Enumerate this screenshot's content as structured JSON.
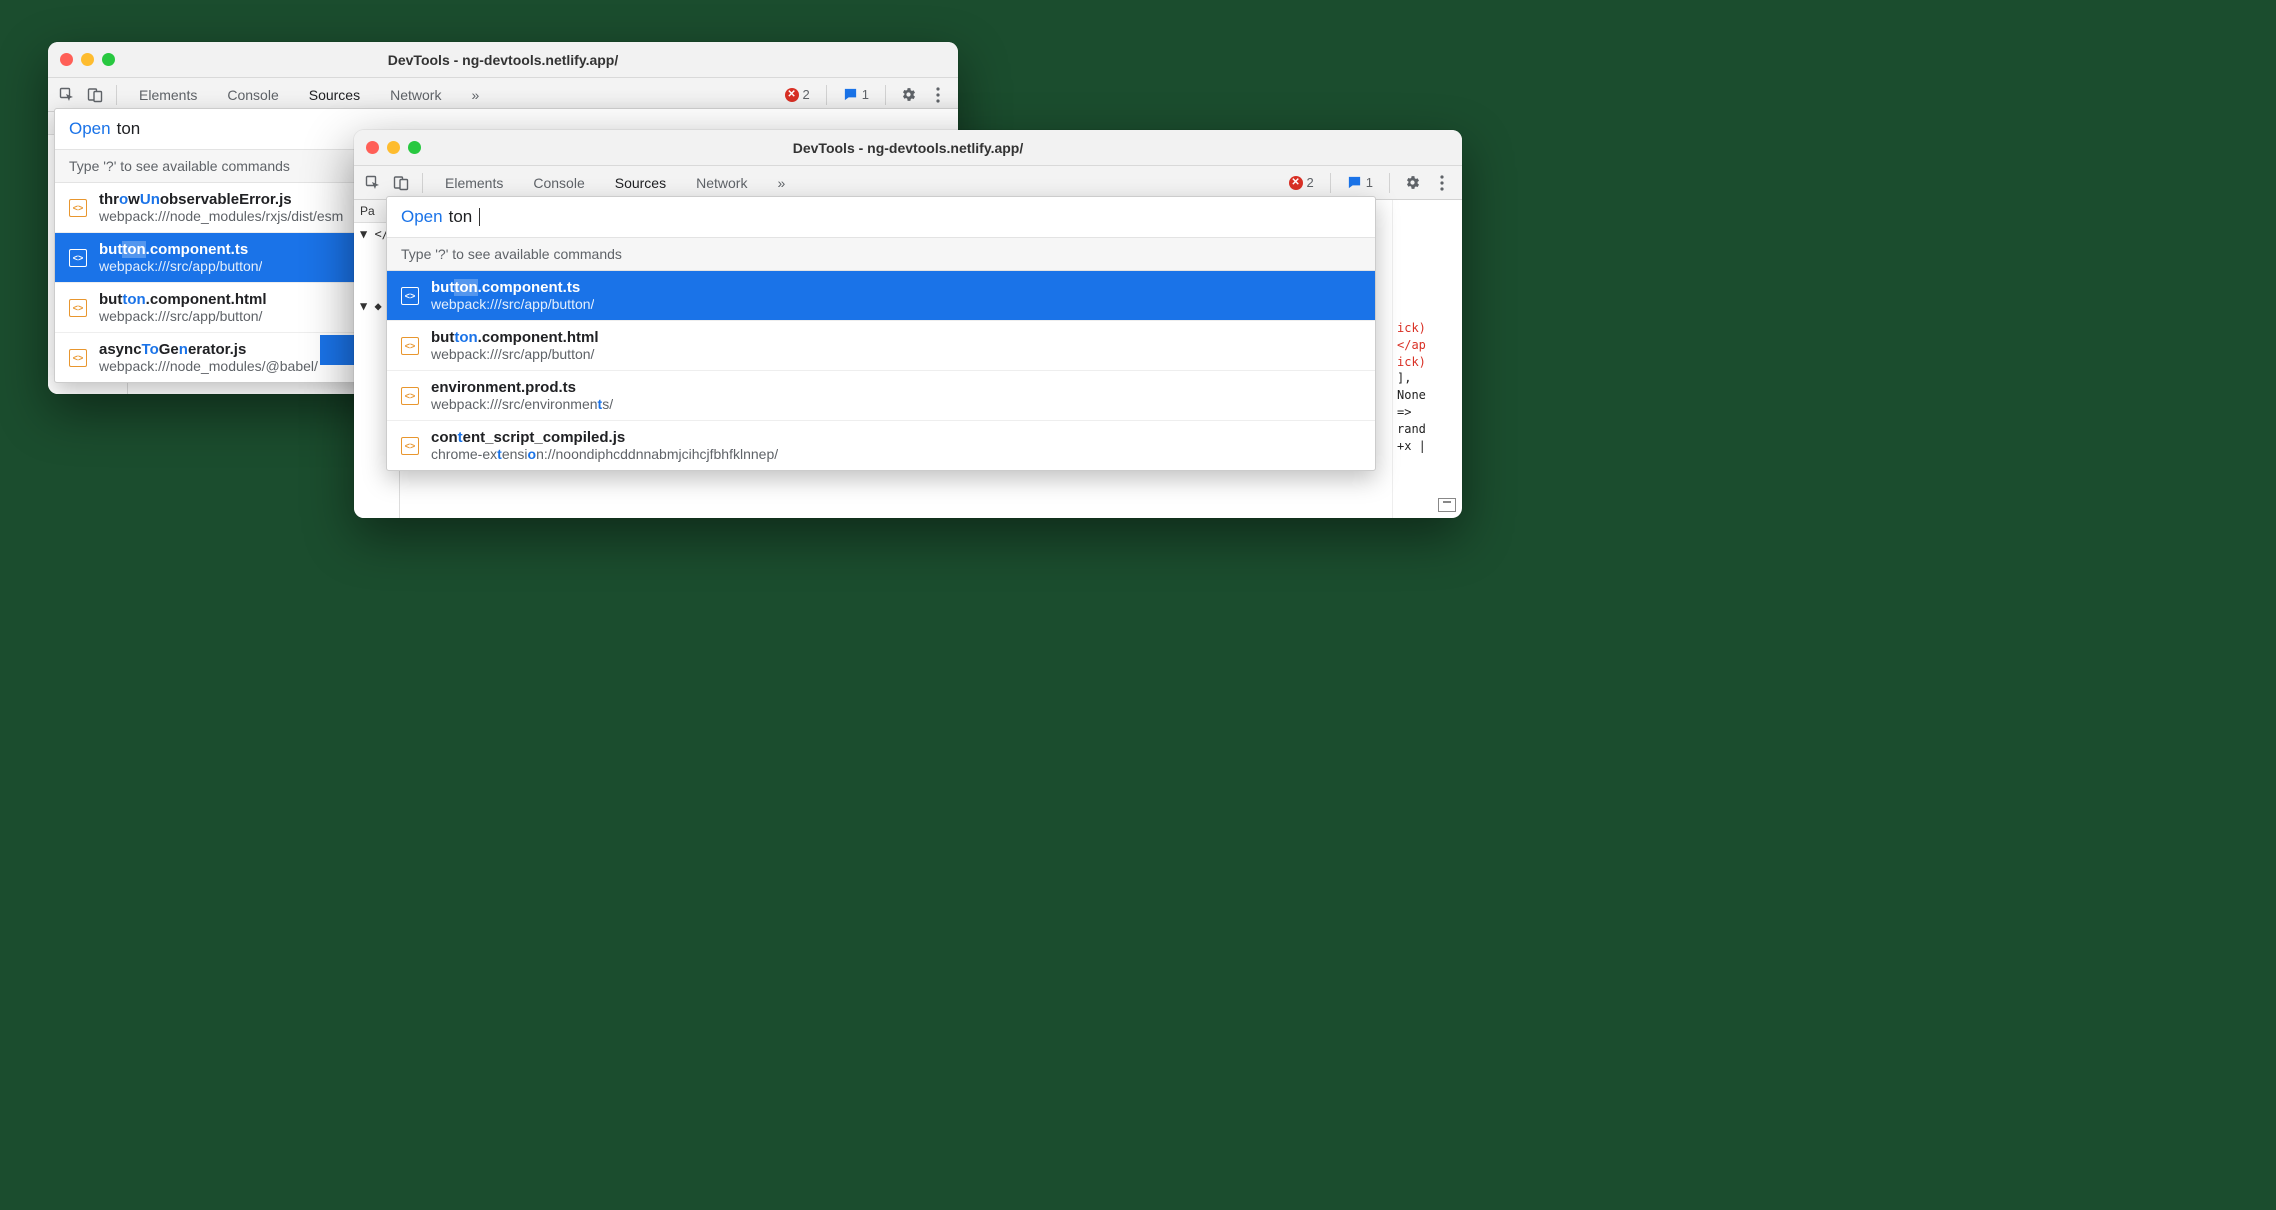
{
  "window_title": "DevTools - ng-devtools.netlify.app/",
  "toolbar": {
    "tabs": [
      "Elements",
      "Console",
      "Sources",
      "Network"
    ],
    "active_tab": "Sources",
    "more_glyph": "»",
    "error_count": "2",
    "message_count": "1"
  },
  "sidebar": {
    "pa_label": "Pa",
    "rows": [
      "▼ </>",
      "  ▼",
      "▼ ◆",
      "  ▶"
    ]
  },
  "command_menu": {
    "prefix": "Open",
    "query": "ton",
    "hint": "Type '?' to see available commands"
  },
  "results_left": [
    {
      "icon": "<>",
      "name_parts": [
        [
          "t",
          0
        ],
        [
          "hr",
          0
        ],
        [
          "o",
          1
        ],
        [
          "w",
          0
        ],
        [
          "U",
          1
        ],
        [
          "n",
          1
        ],
        [
          "observableError.js",
          0
        ]
      ],
      "path": "webpack:///node_modules/rxjs/dist/esm",
      "selected": false
    },
    {
      "icon": "<>",
      "name_parts": [
        [
          "but",
          0
        ],
        [
          "ton",
          2
        ],
        [
          ".component.ts",
          0
        ]
      ],
      "path": "webpack:///src/app/button/",
      "selected": true
    },
    {
      "icon": "<>",
      "name_parts": [
        [
          "but",
          0
        ],
        [
          "ton",
          1
        ],
        [
          ".component.html",
          0
        ]
      ],
      "path": "webpack:///src/app/button/",
      "selected": false
    },
    {
      "icon": "<>",
      "name_parts": [
        [
          "async",
          0
        ],
        [
          "To",
          1
        ],
        [
          "Ge",
          0
        ],
        [
          "n",
          1
        ],
        [
          "erator.js",
          0
        ]
      ],
      "path": "webpack:///node_modules/@babel/",
      "selected": false
    }
  ],
  "results_right": [
    {
      "icon": "<>",
      "name_parts": [
        [
          "but",
          0
        ],
        [
          "ton",
          2
        ],
        [
          ".component.ts",
          0
        ]
      ],
      "path": "webpack:///src/app/button/",
      "selected": true
    },
    {
      "icon": "<>",
      "name_parts": [
        [
          "but",
          0
        ],
        [
          "ton",
          1
        ],
        [
          ".component.html",
          0
        ]
      ],
      "path": "webpack:///src/app/button/",
      "selected": false
    },
    {
      "icon": "<>",
      "name_parts": [
        [
          "environment.prod.ts",
          0
        ]
      ],
      "path_parts": [
        [
          "webpack:///src/environmen",
          0
        ],
        [
          "t",
          1
        ],
        [
          "s/",
          0
        ]
      ],
      "selected": false
    },
    {
      "icon": "<>",
      "name_parts": [
        [
          "con",
          0
        ],
        [
          "t",
          1
        ],
        [
          "ent_script_compiled.js",
          0
        ]
      ],
      "path_parts": [
        [
          "chrome-ex",
          0
        ],
        [
          "t",
          1
        ],
        [
          "ensi",
          0
        ],
        [
          "o",
          1
        ],
        [
          "n://noondiphcddnnabmjcihcjfbhfklnnep/",
          0
        ]
      ],
      "selected": false
    }
  ],
  "codepeek": {
    "lines": [
      "ick)",
      "</ap",
      "ick)",
      "",
      "],",
      "None",
      "",
      "",
      "=>",
      "rand",
      "+x |"
    ]
  }
}
